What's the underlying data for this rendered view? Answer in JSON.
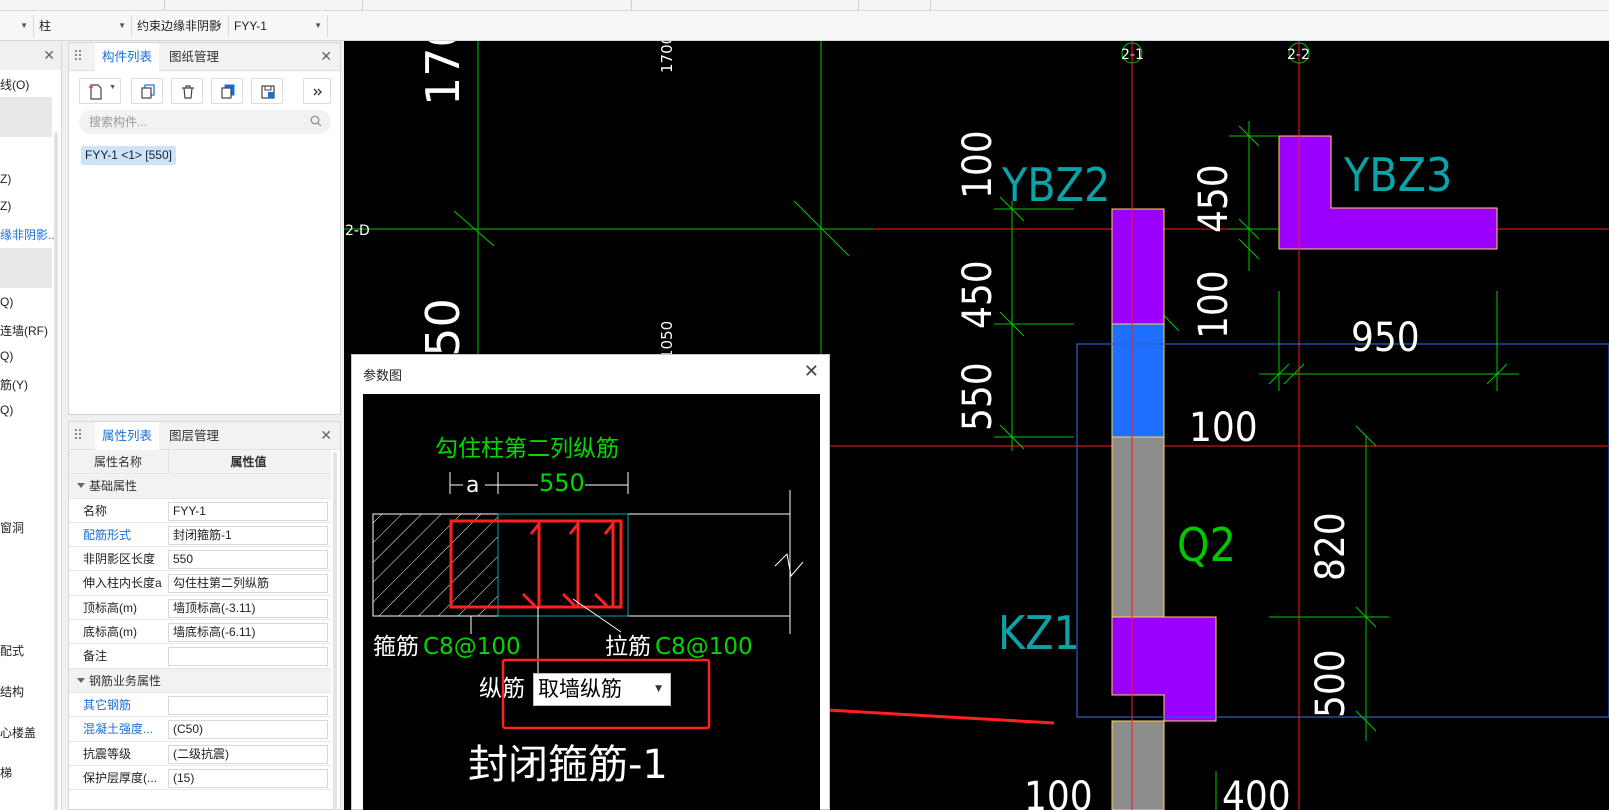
{
  "toolbar": {
    "dd1": "",
    "dd2": "柱",
    "dd3": "约束边缘非阴影",
    "dd4": "FYY-1"
  },
  "left_panel": {
    "items": [
      "线(O)",
      "Z)",
      "Z)",
      "缘非阴影...",
      "Q)",
      "连墙(RF)",
      "Q)",
      "筋(Y)",
      "Q)",
      "窗洞",
      "配式",
      "结构",
      "心楼盖",
      "梯"
    ]
  },
  "component_panel": {
    "tab_active": "构件列表",
    "tab_other": "图纸管理",
    "search_placeholder": "搜索构件...",
    "selected_item": "FYY-1 <1> [550]"
  },
  "property_panel": {
    "tab_active": "属性列表",
    "tab_other": "图层管理",
    "header_name": "属性名称",
    "header_value": "属性值",
    "group1": "基础属性",
    "group2": "钢筋业务属性",
    "rows1": [
      {
        "k": "名称",
        "v": "FYY-1",
        "blue": false
      },
      {
        "k": "配筋形式",
        "v": "封闭箍筋-1",
        "blue": true
      },
      {
        "k": "非阴影区长度",
        "v": "550",
        "blue": false
      },
      {
        "k": "伸入柱内长度a",
        "v": "勾住柱第二列纵筋",
        "blue": false
      },
      {
        "k": "顶标高(m)",
        "v": "墙顶标高(-3.11)",
        "blue": false
      },
      {
        "k": "底标高(m)",
        "v": "墙底标高(-6.11)",
        "blue": false
      },
      {
        "k": "备注",
        "v": "",
        "blue": false
      }
    ],
    "rows2": [
      {
        "k": "其它钢筋",
        "v": "",
        "blue": true
      },
      {
        "k": "混凝土强度...",
        "v": "(C50)",
        "blue": true
      },
      {
        "k": "抗震等级",
        "v": "(二级抗震)",
        "blue": false
      },
      {
        "k": "保护层厚度(...",
        "v": "(15)",
        "blue": false
      }
    ]
  },
  "canvas": {
    "axis_labels": [
      "2-1",
      "2-2",
      "2-D"
    ],
    "dims": [
      "170",
      "1700",
      "050",
      "1050",
      "100",
      "450",
      "550",
      "450",
      "100",
      "950",
      "100",
      "820",
      "500",
      "100",
      "400"
    ],
    "labels": [
      "YBZ2",
      "YBZ3",
      "Q2",
      "KZ1"
    ]
  },
  "dialog": {
    "title": "参数图",
    "top_label": "勾住柱第二列纵筋",
    "a_label": "a",
    "dim_label": "550",
    "stirrup_label": "箍筋",
    "stirrup_value": "C8@100",
    "tie_label": "拉筋",
    "tie_value": "C8@100",
    "long_label": "纵筋",
    "long_select": "取墙纵筋",
    "caption": "封闭箍筋-1"
  },
  "colors": {
    "accent": "#1a6fd6",
    "cad_green": "#00d800",
    "cad_cyan": "#0aa3a8",
    "wall_purple": "#9b00ff",
    "wall_blue": "#1e6fff",
    "wall_gray": "#8c8c8c",
    "red": "#ff2020"
  }
}
